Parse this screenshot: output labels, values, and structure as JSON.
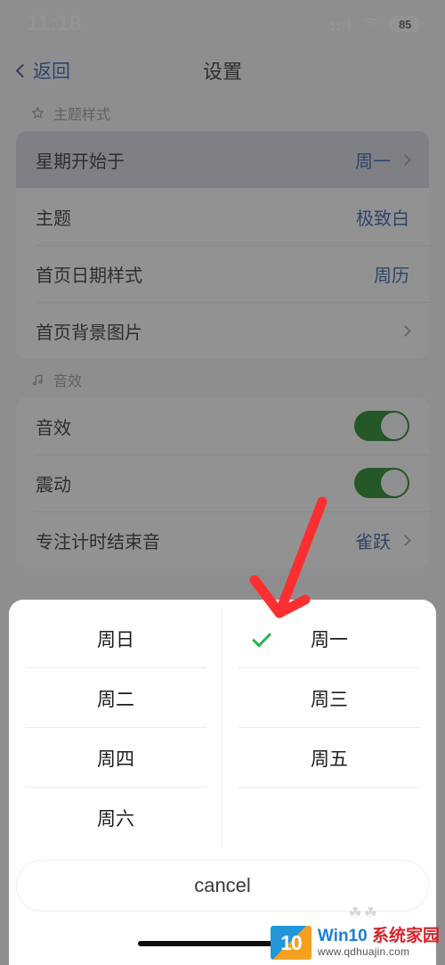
{
  "status_bar": {
    "time": "11:18",
    "signal_icon": "signal-dots-icon",
    "wifi_icon": "wifi-icon",
    "battery_level": "85",
    "battery_icon": "battery-icon"
  },
  "nav": {
    "back_label": "返回",
    "back_icon": "chevron-left-icon",
    "title": "设置"
  },
  "sections": [
    {
      "icon": "sparkle-star-icon",
      "header": "主题样式",
      "rows": [
        {
          "label": "星期开始于",
          "value": "周一",
          "accessory": "chevron-right-icon",
          "highlighted": true
        },
        {
          "label": "主题",
          "value": "极致白",
          "accessory": "none",
          "highlighted": false
        },
        {
          "label": "首页日期样式",
          "value": "周历",
          "accessory": "none",
          "highlighted": false
        },
        {
          "label": "首页背景图片",
          "value": "",
          "accessory": "chevron-right-icon",
          "highlighted": false
        }
      ]
    },
    {
      "icon": "music-note-icon",
      "header": "音效",
      "rows": [
        {
          "label": "音效",
          "value": "",
          "accessory": "toggle-on",
          "highlighted": false
        },
        {
          "label": "震动",
          "value": "",
          "accessory": "toggle-on",
          "highlighted": false
        },
        {
          "label": "专注计时结束音",
          "value": "雀跃",
          "accessory": "chevron-right-icon",
          "highlighted": false
        }
      ]
    }
  ],
  "action_sheet": {
    "options": [
      {
        "label": "周日",
        "selected": false
      },
      {
        "label": "周一",
        "selected": true
      },
      {
        "label": "周二",
        "selected": false
      },
      {
        "label": "周三",
        "selected": false
      },
      {
        "label": "周四",
        "selected": false
      },
      {
        "label": "周五",
        "selected": false
      },
      {
        "label": "周六",
        "selected": false
      },
      {
        "label": "",
        "selected": false
      }
    ],
    "check_icon": "check-icon",
    "cancel_label": "cancel"
  },
  "annotation": {
    "type": "red-arrow",
    "color": "#fb2f2f",
    "points_to": "check-icon"
  },
  "watermark": {
    "logo_text": "10",
    "brand_prefix": "Win10",
    "brand_suffix": "系统家园",
    "url": "www.qdhuajin.com"
  },
  "colors": {
    "accent_blue": "#1f4f9c",
    "toggle_green": "#0a7a12",
    "check_green": "#2bb24c",
    "arrow_red": "#fb2f2f",
    "highlight_row": "#cfd3dd"
  }
}
